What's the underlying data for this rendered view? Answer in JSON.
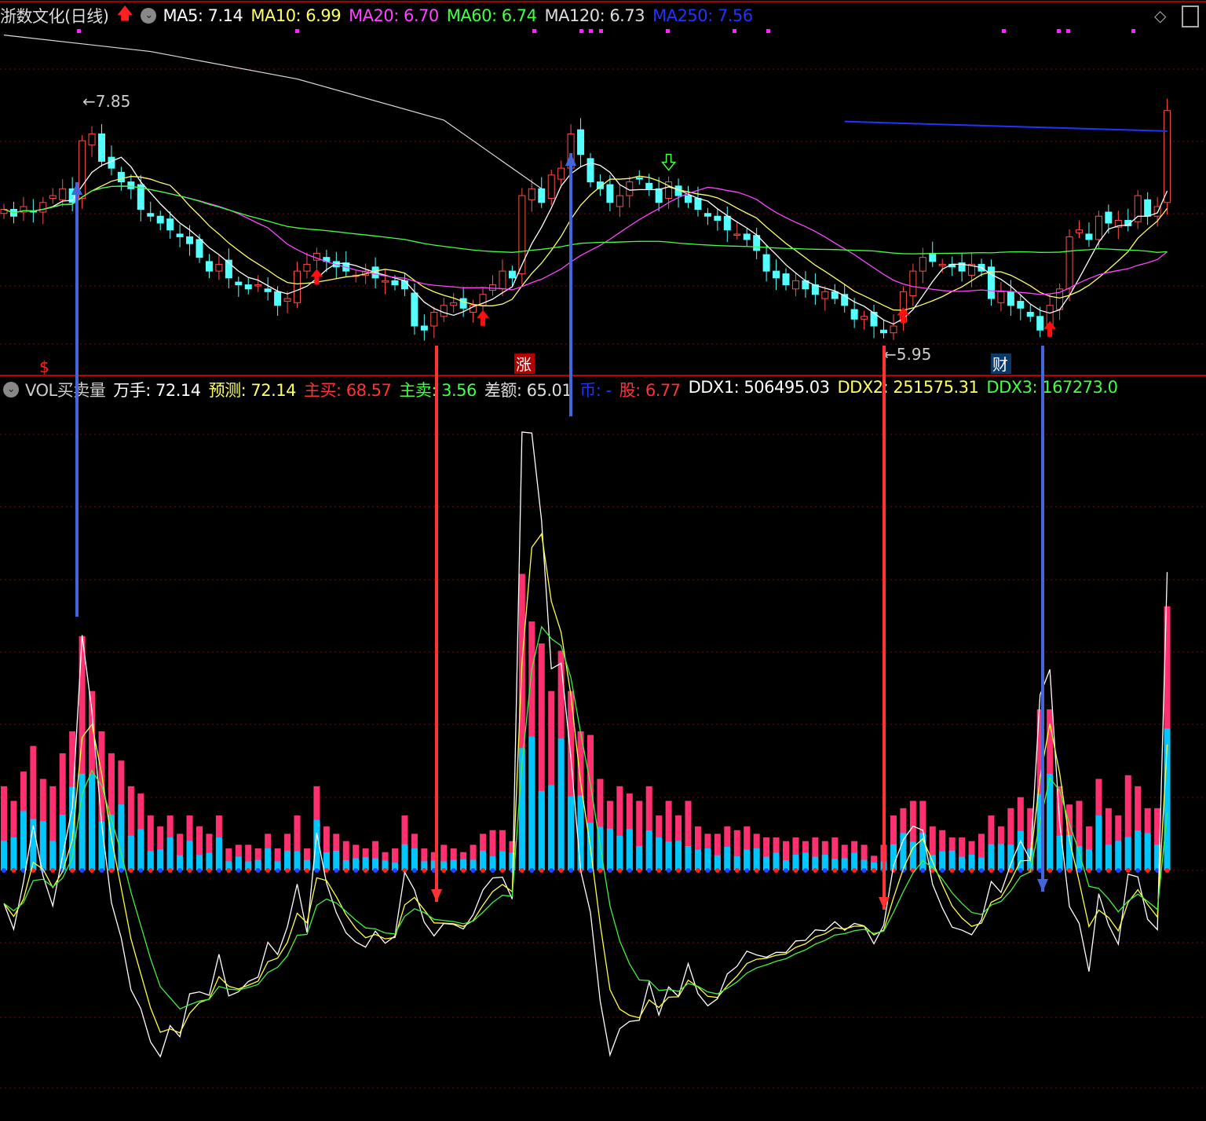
{
  "header": {
    "stock_name": "浙数文化(日线)",
    "ma": [
      {
        "label": "MA5: 7.14",
        "color": "#ffffff"
      },
      {
        "label": "MA10: 6.99",
        "color": "#ffff66"
      },
      {
        "label": "MA20: 6.70",
        "color": "#ff44ff"
      },
      {
        "label": "MA60: 6.74",
        "color": "#44ff44"
      },
      {
        "label": "MA120: 6.73",
        "color": "#dddddd"
      },
      {
        "label": "MA250: 7.56",
        "color": "#2233ff"
      }
    ]
  },
  "volume_header": {
    "title": "VOL买卖量",
    "items": [
      {
        "label": "万手: 72.14",
        "color": "#ffffff"
      },
      {
        "label": "预测: 72.14",
        "color": "#ffff66"
      },
      {
        "label": "主买: 68.57",
        "color": "#ff3333"
      },
      {
        "label": "主卖: 3.56",
        "color": "#44ff44"
      },
      {
        "label": "差额: 65.01",
        "color": "#dddddd"
      },
      {
        "label": "币: -",
        "color": "#2233ff"
      },
      {
        "label": "股: 6.77",
        "color": "#ff3333"
      },
      {
        "label": "DDX1: 506495.03",
        "color": "#ffffff"
      },
      {
        "label": "DDX2: 251575.31",
        "color": "#ffff66"
      },
      {
        "label": "DDX3: 167273.0",
        "color": "#44ff44"
      }
    ]
  },
  "annotations": {
    "high": "7.85",
    "low": "5.95",
    "marker_s": "$",
    "marker_zhang": "涨",
    "marker_cai": "财"
  },
  "colors": {
    "up": "#ff4d4d",
    "down": "#54ffff",
    "vol_total": "#ff3070",
    "vol_buy": "#00c8ff",
    "grid": "#8a0000"
  },
  "chart_data": {
    "type": "candlestick",
    "price_range": [
      5.95,
      7.85
    ],
    "closes": [
      7.0,
      6.95,
      7.02,
      6.98,
      7.05,
      7.1,
      7.15,
      7.05,
      7.5,
      7.55,
      7.35,
      7.3,
      7.2,
      7.15,
      7.0,
      6.95,
      6.9,
      6.85,
      6.8,
      6.75,
      6.65,
      6.55,
      6.6,
      6.5,
      6.45,
      6.42,
      6.45,
      6.4,
      6.3,
      6.35,
      6.55,
      6.6,
      6.68,
      6.62,
      6.58,
      6.55,
      6.52,
      6.55,
      6.5,
      6.48,
      6.45,
      6.42,
      6.15,
      6.12,
      6.25,
      6.3,
      6.32,
      6.28,
      6.3,
      6.38,
      6.45,
      6.55,
      6.5,
      7.1,
      7.15,
      7.05,
      7.25,
      7.3,
      7.55,
      7.4,
      7.2,
      7.15,
      7.05,
      7.1,
      7.2,
      7.22,
      7.15,
      7.05,
      7.2,
      7.1,
      7.05,
      7.0,
      6.95,
      6.92,
      6.85,
      6.82,
      6.78,
      6.7,
      6.55,
      6.5,
      6.45,
      6.48,
      6.42,
      6.38,
      6.4,
      6.35,
      6.3,
      6.2,
      6.22,
      6.15,
      6.1,
      6.15,
      6.4,
      6.55,
      6.65,
      6.62,
      6.6,
      6.58,
      6.55,
      6.6,
      6.55,
      6.35,
      6.4,
      6.3,
      6.28,
      6.22,
      6.12,
      6.3,
      6.42,
      6.8,
      6.85,
      6.78,
      6.95,
      6.9,
      6.92,
      6.88,
      7.1,
      6.95,
      7.02,
      7.72
    ],
    "volume_wanshou": [
      23,
      19,
      27,
      34,
      25,
      23,
      32,
      38,
      64,
      49,
      38,
      32,
      30,
      23,
      21,
      15,
      12,
      15,
      10,
      15,
      12,
      10,
      15,
      6,
      7,
      7,
      6,
      10,
      6,
      10,
      15,
      6,
      23,
      12,
      10,
      8,
      7,
      6,
      8,
      5,
      6,
      15,
      10,
      6,
      5,
      7,
      6,
      5,
      7,
      10,
      11,
      11,
      8,
      81,
      68,
      62,
      49,
      60,
      49,
      38,
      37,
      25,
      19,
      23,
      21,
      19,
      23,
      15,
      19,
      15,
      19,
      12,
      10,
      10,
      12,
      11,
      12,
      10,
      9,
      9,
      8,
      9,
      8,
      9,
      8,
      9,
      7,
      8,
      7,
      4,
      7,
      15,
      17,
      19,
      19,
      12,
      11,
      9,
      9,
      8,
      10,
      15,
      12,
      17,
      20,
      17,
      44,
      44,
      23,
      18,
      19,
      12,
      25,
      17,
      15,
      26,
      23,
      17,
      17,
      72.14
    ],
    "ma120_points": [
      [
        0,
        8.27
      ],
      [
        15,
        8.15
      ],
      [
        30,
        7.95
      ],
      [
        45,
        7.65
      ],
      [
        55,
        7.15
      ]
    ],
    "ma250_points": [
      [
        86,
        7.64
      ],
      [
        119,
        7.57
      ]
    ],
    "up_arrow_idx": [
      32,
      49,
      92,
      107
    ],
    "down_arrow_idx": [
      68
    ]
  }
}
